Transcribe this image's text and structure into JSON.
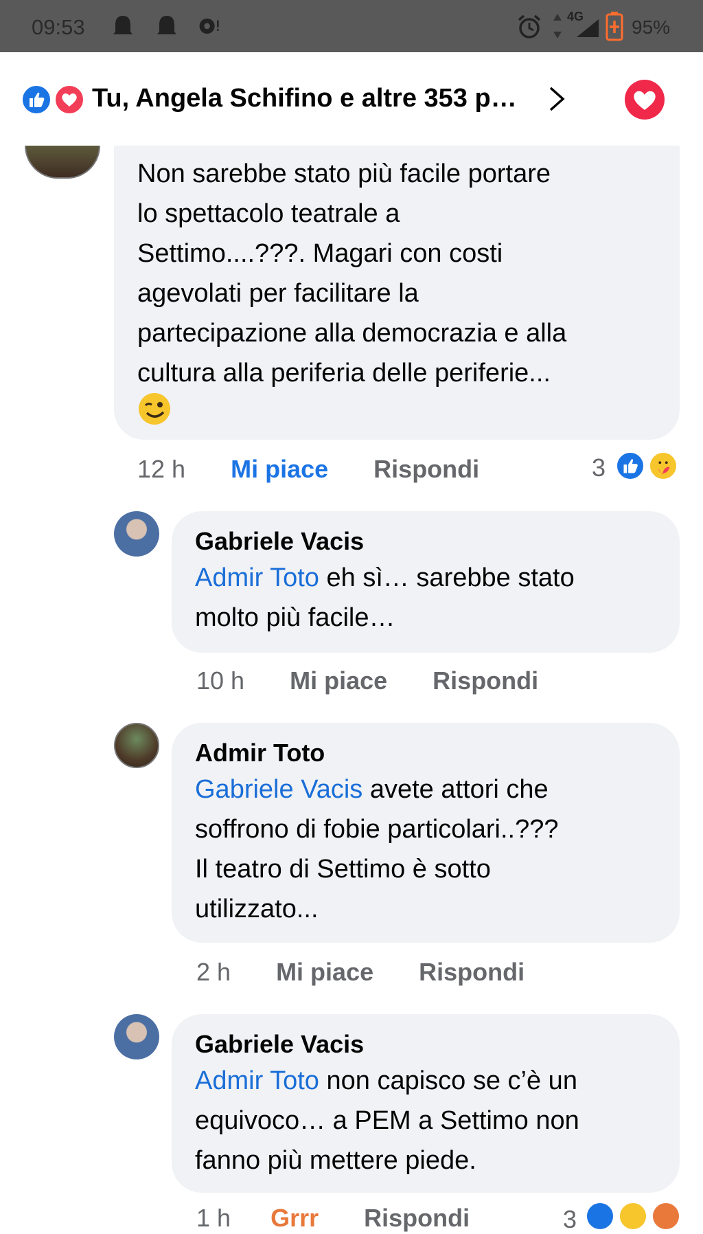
{
  "status_bar": {
    "time": "09:53",
    "network": "4G",
    "battery": "95%",
    "icons": [
      "notification-bell-icon",
      "notification-bell-icon",
      "messenger-icon",
      "alarm-icon",
      "data-arrows-icon",
      "signal-icon",
      "battery-charging-icon"
    ]
  },
  "header": {
    "reactions_summary": "Tu, Angela Schifino e altre 353 p…",
    "reaction_icons": [
      "like-icon",
      "love-icon"
    ],
    "colors": {
      "like": "#1b74e4",
      "love": "#f33e58"
    }
  },
  "comments": [
    {
      "author": "",
      "text_lines": [
        "Non sarebbe stato più facile portare",
        "lo spettacolo teatrale a",
        "Settimo....???. Magari con costi",
        "agevolati per facilitare la",
        "partecipazione alla democrazia e alla",
        "cultura alla periferia delle periferie..."
      ],
      "emoji": "😉",
      "time": "12 h",
      "like_label": "Mi piace",
      "reply_label": "Rispondi",
      "reaction_count": "3",
      "liked": true
    },
    {
      "author": "Gabriele Vacis",
      "mention": "Admir Toto",
      "text_first": " eh sì… sarebbe stato",
      "text_lines": [
        "molto più facile…"
      ],
      "time": "10 h",
      "like_label": "Mi piace",
      "reply_label": "Rispondi"
    },
    {
      "author": "Admir Toto",
      "mention": "Gabriele Vacis",
      "text_first": "  avete attori che",
      "text_lines": [
        "soffrono di fobie particolari..???",
        "Il teatro di Settimo è sotto",
        "utilizzato..."
      ],
      "time": "2 h",
      "like_label": "Mi piace",
      "reply_label": "Rispondi"
    },
    {
      "author": "Gabriele Vacis",
      "mention": "Admir Toto",
      "text_first": " non capisco se c’è un",
      "text_lines": [
        "equivoco… a PEM a Settimo non",
        "fanno più mettere piede."
      ],
      "time": "1 h",
      "like_label": "Grrr",
      "reply_label": "Rispondi",
      "reaction_count": "3"
    }
  ]
}
